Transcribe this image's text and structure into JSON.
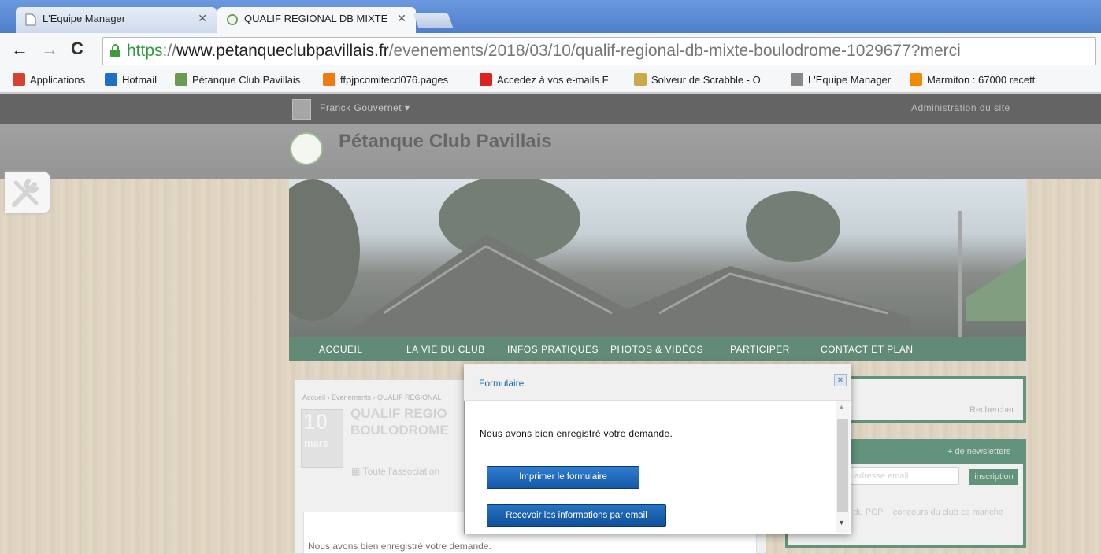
{
  "browser": {
    "tabs": [
      {
        "label": "L'Equipe Manager",
        "active": false
      },
      {
        "label": "QUALIF REGIONAL DB MIXTE",
        "active": true
      }
    ],
    "url_scheme": "https",
    "url_sep": "://",
    "url_host": "www.petanqueclubpavillais.fr",
    "url_path": "/evenements/2018/03/10/qualif-regional-db-mixte-boulodrome-1029677?merci",
    "bookmarks": [
      {
        "label": "Applications",
        "icon": "apps-grid-icon",
        "color": "#d8412f"
      },
      {
        "label": "Hotmail",
        "icon": "outlook-icon",
        "color": "#1e6fc6"
      },
      {
        "label": "Pétanque Club Pavillais",
        "icon": "club-logo-icon",
        "color": "#6a9a54"
      },
      {
        "label": "ffpjpcomitecd076.pages",
        "icon": "pages-icon",
        "color": "#f07b14"
      },
      {
        "label": "Accedez à vos e-mails F",
        "icon": "mail-icon",
        "color": "#d22"
      },
      {
        "label": "Solveur de Scrabble - O",
        "icon": "scrabble-icon",
        "color": "#c9a94a"
      },
      {
        "label": "L'Equipe Manager",
        "icon": "page-icon",
        "color": "#888"
      },
      {
        "label": "Marmiton : 67000 recett",
        "icon": "marmiton-icon",
        "color": "#f28a00"
      }
    ]
  },
  "site": {
    "user": "Franck Gouvernet ▾",
    "admin_link": "Administration du site",
    "title": "Pétanque Club Pavillais",
    "nav": [
      "ACCUEIL",
      "LA VIE DU CLUB",
      "INFOS PRATIQUES",
      "PHOTOS & VIDÉOS",
      "PARTICIPER",
      "CONTACT ET PLAN"
    ]
  },
  "event": {
    "breadcrumb": "Accueil › Evenements › QUALIF REGIONAL",
    "day": "10",
    "month": "mars",
    "title_line1": "QUALIF REGIO",
    "title_line2": "BOULODROME",
    "organizer": "Toute l'association",
    "confirmation": "Nous avons bien enregistré votre demande."
  },
  "sidebar": {
    "search_button": "Rechercher",
    "newsletter_link": "+ de newsletters",
    "email_placeholder": "tre adresse email",
    "subscribe_button": "inscription",
    "text": "s du PCP + concours du club ce manche"
  },
  "modal": {
    "title": "Formulaire",
    "close": "×",
    "message": "Nous avons bien enregistré votre demande.",
    "print_button": "Imprimer le formulaire",
    "email_button": "Recevoir les informations par email"
  }
}
